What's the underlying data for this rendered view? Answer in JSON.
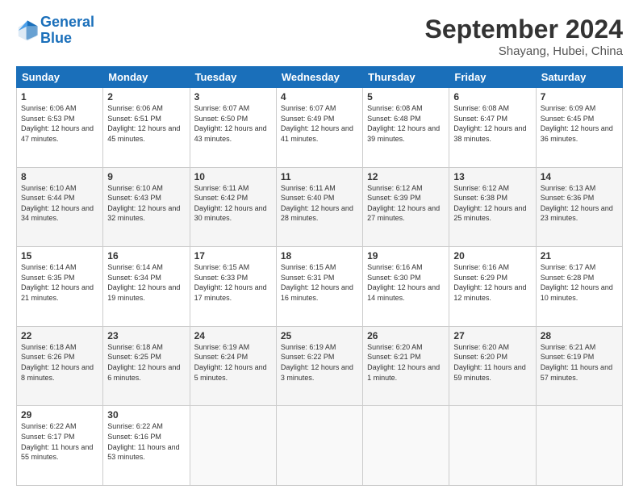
{
  "header": {
    "logo_line1": "General",
    "logo_line2": "Blue",
    "month_title": "September 2024",
    "subtitle": "Shayang, Hubei, China"
  },
  "days_of_week": [
    "Sunday",
    "Monday",
    "Tuesday",
    "Wednesday",
    "Thursday",
    "Friday",
    "Saturday"
  ],
  "weeks": [
    [
      {
        "day": "1",
        "sunrise": "6:06 AM",
        "sunset": "6:53 PM",
        "daylight": "12 hours and 47 minutes."
      },
      {
        "day": "2",
        "sunrise": "6:06 AM",
        "sunset": "6:51 PM",
        "daylight": "12 hours and 45 minutes."
      },
      {
        "day": "3",
        "sunrise": "6:07 AM",
        "sunset": "6:50 PM",
        "daylight": "12 hours and 43 minutes."
      },
      {
        "day": "4",
        "sunrise": "6:07 AM",
        "sunset": "6:49 PM",
        "daylight": "12 hours and 41 minutes."
      },
      {
        "day": "5",
        "sunrise": "6:08 AM",
        "sunset": "6:48 PM",
        "daylight": "12 hours and 39 minutes."
      },
      {
        "day": "6",
        "sunrise": "6:08 AM",
        "sunset": "6:47 PM",
        "daylight": "12 hours and 38 minutes."
      },
      {
        "day": "7",
        "sunrise": "6:09 AM",
        "sunset": "6:45 PM",
        "daylight": "12 hours and 36 minutes."
      }
    ],
    [
      {
        "day": "8",
        "sunrise": "6:10 AM",
        "sunset": "6:44 PM",
        "daylight": "12 hours and 34 minutes."
      },
      {
        "day": "9",
        "sunrise": "6:10 AM",
        "sunset": "6:43 PM",
        "daylight": "12 hours and 32 minutes."
      },
      {
        "day": "10",
        "sunrise": "6:11 AM",
        "sunset": "6:42 PM",
        "daylight": "12 hours and 30 minutes."
      },
      {
        "day": "11",
        "sunrise": "6:11 AM",
        "sunset": "6:40 PM",
        "daylight": "12 hours and 28 minutes."
      },
      {
        "day": "12",
        "sunrise": "6:12 AM",
        "sunset": "6:39 PM",
        "daylight": "12 hours and 27 minutes."
      },
      {
        "day": "13",
        "sunrise": "6:12 AM",
        "sunset": "6:38 PM",
        "daylight": "12 hours and 25 minutes."
      },
      {
        "day": "14",
        "sunrise": "6:13 AM",
        "sunset": "6:36 PM",
        "daylight": "12 hours and 23 minutes."
      }
    ],
    [
      {
        "day": "15",
        "sunrise": "6:14 AM",
        "sunset": "6:35 PM",
        "daylight": "12 hours and 21 minutes."
      },
      {
        "day": "16",
        "sunrise": "6:14 AM",
        "sunset": "6:34 PM",
        "daylight": "12 hours and 19 minutes."
      },
      {
        "day": "17",
        "sunrise": "6:15 AM",
        "sunset": "6:33 PM",
        "daylight": "12 hours and 17 minutes."
      },
      {
        "day": "18",
        "sunrise": "6:15 AM",
        "sunset": "6:31 PM",
        "daylight": "12 hours and 16 minutes."
      },
      {
        "day": "19",
        "sunrise": "6:16 AM",
        "sunset": "6:30 PM",
        "daylight": "12 hours and 14 minutes."
      },
      {
        "day": "20",
        "sunrise": "6:16 AM",
        "sunset": "6:29 PM",
        "daylight": "12 hours and 12 minutes."
      },
      {
        "day": "21",
        "sunrise": "6:17 AM",
        "sunset": "6:28 PM",
        "daylight": "12 hours and 10 minutes."
      }
    ],
    [
      {
        "day": "22",
        "sunrise": "6:18 AM",
        "sunset": "6:26 PM",
        "daylight": "12 hours and 8 minutes."
      },
      {
        "day": "23",
        "sunrise": "6:18 AM",
        "sunset": "6:25 PM",
        "daylight": "12 hours and 6 minutes."
      },
      {
        "day": "24",
        "sunrise": "6:19 AM",
        "sunset": "6:24 PM",
        "daylight": "12 hours and 5 minutes."
      },
      {
        "day": "25",
        "sunrise": "6:19 AM",
        "sunset": "6:22 PM",
        "daylight": "12 hours and 3 minutes."
      },
      {
        "day": "26",
        "sunrise": "6:20 AM",
        "sunset": "6:21 PM",
        "daylight": "12 hours and 1 minute."
      },
      {
        "day": "27",
        "sunrise": "6:20 AM",
        "sunset": "6:20 PM",
        "daylight": "11 hours and 59 minutes."
      },
      {
        "day": "28",
        "sunrise": "6:21 AM",
        "sunset": "6:19 PM",
        "daylight": "11 hours and 57 minutes."
      }
    ],
    [
      {
        "day": "29",
        "sunrise": "6:22 AM",
        "sunset": "6:17 PM",
        "daylight": "11 hours and 55 minutes."
      },
      {
        "day": "30",
        "sunrise": "6:22 AM",
        "sunset": "6:16 PM",
        "daylight": "11 hours and 53 minutes."
      },
      null,
      null,
      null,
      null,
      null
    ]
  ]
}
